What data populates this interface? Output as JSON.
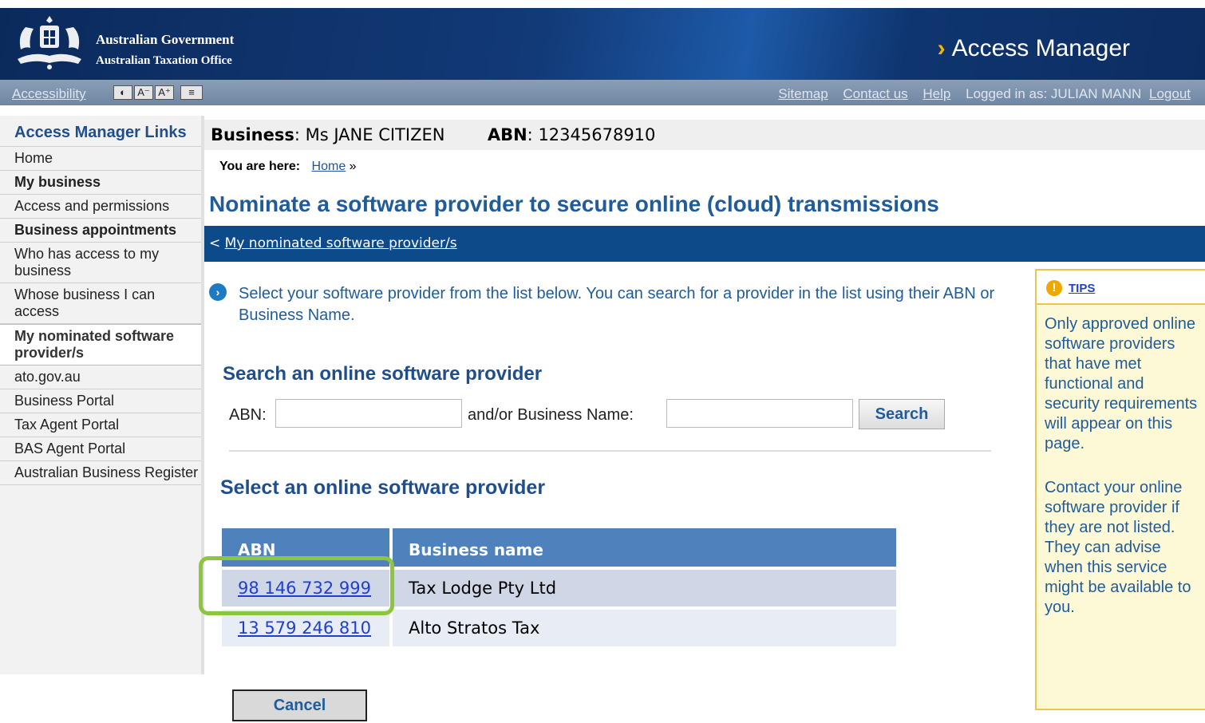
{
  "header": {
    "gov_line1": "Australian Government",
    "gov_line2": "Australian Taxation Office",
    "app_title": "Access Manager",
    "accent_color": "#f5b700"
  },
  "utility_bar": {
    "accessibility": "Accessibility",
    "tools": [
      "◐",
      "A⁻",
      "A⁺",
      "≡"
    ],
    "links": [
      "Sitemap",
      "Contact us",
      "Help"
    ],
    "logged_in_prefix": "Logged in as: JULIAN MANN",
    "logout": "Logout"
  },
  "sidebar": {
    "items": [
      {
        "label": "Access Manager Links",
        "style": "head"
      },
      {
        "label": "Home",
        "style": "normal"
      },
      {
        "label": "My business",
        "style": "bold"
      },
      {
        "label": "Access and permissions",
        "style": "normal"
      },
      {
        "label": "Business appointments",
        "style": "bold"
      },
      {
        "label": "Who has access to my business",
        "style": "normal"
      },
      {
        "label": "Whose business I can access",
        "style": "normal"
      },
      {
        "label": "My nominated software provider/s",
        "style": "active"
      },
      {
        "label": "ato.gov.au",
        "style": "normal"
      },
      {
        "label": "Business Portal",
        "style": "normal"
      },
      {
        "label": "Tax Agent Portal",
        "style": "normal"
      },
      {
        "label": "BAS Agent Portal",
        "style": "normal"
      },
      {
        "label": "Australian Business Register",
        "style": "normal"
      }
    ]
  },
  "business_bar": {
    "business_label": "Business",
    "business_value": "Ms JANE CITIZEN",
    "abn_label": "ABN",
    "abn_value": "12345678910"
  },
  "breadcrumb": {
    "prefix": "You are here:",
    "home": "Home",
    "sep": "»"
  },
  "page_title": "Nominate a software provider to secure online (cloud) transmissions",
  "nav_bar": {
    "back_glyph": "<",
    "back_link": "My nominated software provider/s"
  },
  "intro_text": "Select your software provider from the list below. You can search for a provider in the list using their ABN or Business Name.",
  "search": {
    "heading": "Search an online software provider",
    "abn_label": "ABN:",
    "abn_value": "",
    "name_label": "and/or Business Name:",
    "name_value": "",
    "button": "Search"
  },
  "select": {
    "heading": "Select an online software provider",
    "columns": [
      "ABN",
      "Business name"
    ],
    "rows": [
      {
        "abn": "98 146 732 999",
        "name": "Tax Lodge Pty Ltd"
      },
      {
        "abn": "13 579 246 810",
        "name": "Alto Stratos Tax"
      }
    ],
    "highlight_color": "#8cc63f"
  },
  "cancel_button": "Cancel",
  "tips": {
    "icon": "!",
    "title": "TIPS",
    "lines_1": [
      "Only approved online",
      "software providers",
      "that have met",
      "functional and",
      "security requirements",
      "will appear on this",
      "page."
    ],
    "lines_2": [
      "Contact your online",
      "software provider if",
      "they are not listed.",
      "They can advise",
      "when this service",
      "might be available to",
      "you."
    ]
  }
}
